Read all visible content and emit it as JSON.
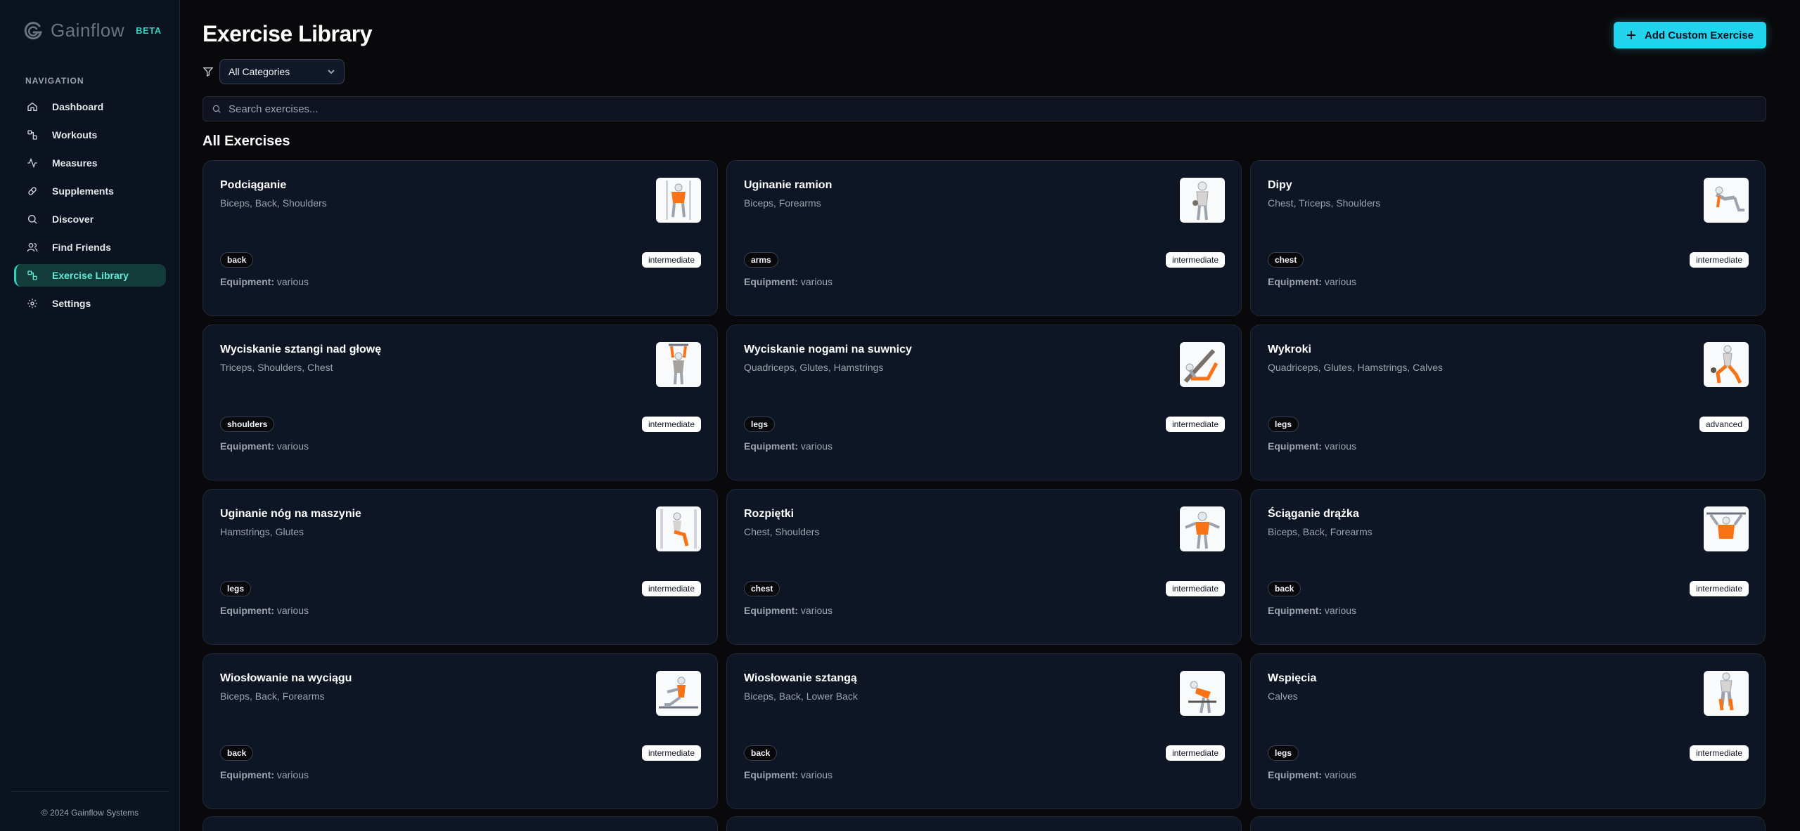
{
  "brand": {
    "name": "Gainflow",
    "beta": "BETA"
  },
  "sidebar": {
    "heading": "NAVIGATION",
    "items": [
      {
        "label": "Dashboard",
        "icon": "home-icon",
        "active": false
      },
      {
        "label": "Workouts",
        "icon": "dumbbell-icon",
        "active": false
      },
      {
        "label": "Measures",
        "icon": "activity-icon",
        "active": false
      },
      {
        "label": "Supplements",
        "icon": "pill-icon",
        "active": false
      },
      {
        "label": "Discover",
        "icon": "search-icon",
        "active": false
      },
      {
        "label": "Find Friends",
        "icon": "users-icon",
        "active": false
      },
      {
        "label": "Exercise Library",
        "icon": "dumbbell-icon",
        "active": true
      },
      {
        "label": "Settings",
        "icon": "gear-icon",
        "active": false
      }
    ],
    "footer": "© 2024 Gainflow Systems"
  },
  "header": {
    "title": "Exercise Library",
    "add_button": "Add Custom Exercise"
  },
  "filter": {
    "selected": "All Categories"
  },
  "search": {
    "placeholder": "Search exercises..."
  },
  "section_title": "All Exercises",
  "equipment_label": "Equipment:",
  "exercises": [
    {
      "name": "Podciąganie",
      "muscles": "Biceps, Back, Shoulders",
      "category": "back",
      "level": "intermediate",
      "equipment": "various"
    },
    {
      "name": "Uginanie ramion",
      "muscles": "Biceps, Forearms",
      "category": "arms",
      "level": "intermediate",
      "equipment": "various"
    },
    {
      "name": "Dipy",
      "muscles": "Chest, Triceps, Shoulders",
      "category": "chest",
      "level": "intermediate",
      "equipment": "various"
    },
    {
      "name": "Wyciskanie sztangi nad głowę",
      "muscles": "Triceps, Shoulders, Chest",
      "category": "shoulders",
      "level": "intermediate",
      "equipment": "various"
    },
    {
      "name": "Wyciskanie nogami na suwnicy",
      "muscles": "Quadriceps, Glutes, Hamstrings",
      "category": "legs",
      "level": "intermediate",
      "equipment": "various"
    },
    {
      "name": "Wykroki",
      "muscles": "Quadriceps, Glutes, Hamstrings, Calves",
      "category": "legs",
      "level": "advanced",
      "equipment": "various"
    },
    {
      "name": "Uginanie nóg na maszynie",
      "muscles": "Hamstrings, Glutes",
      "category": "legs",
      "level": "intermediate",
      "equipment": "various"
    },
    {
      "name": "Rozpiętki",
      "muscles": "Chest, Shoulders",
      "category": "chest",
      "level": "intermediate",
      "equipment": "various"
    },
    {
      "name": "Ściąganie drążka",
      "muscles": "Biceps, Back, Forearms",
      "category": "back",
      "level": "intermediate",
      "equipment": "various"
    },
    {
      "name": "Wiosłowanie na wyciągu",
      "muscles": "Biceps, Back, Forearms",
      "category": "back",
      "level": "intermediate",
      "equipment": "various"
    },
    {
      "name": "Wiosłowanie sztangą",
      "muscles": "Biceps, Back, Lower Back",
      "category": "back",
      "level": "intermediate",
      "equipment": "various"
    },
    {
      "name": "Wspięcia",
      "muscles": "Calves",
      "category": "legs",
      "level": "intermediate",
      "equipment": "various"
    }
  ],
  "colors": {
    "accent": "#2dd4bf",
    "button": "#22d3ee",
    "highlight": "#f97316"
  }
}
